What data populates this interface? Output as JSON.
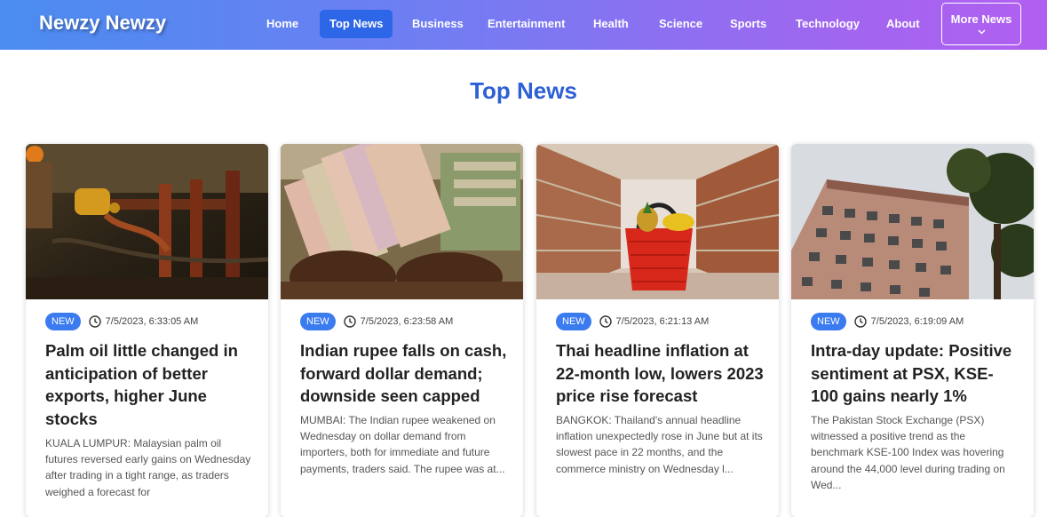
{
  "navbar": {
    "brand": "Newzy Newzy",
    "links": [
      "Home",
      "Top News",
      "Business",
      "Entertainment",
      "Health",
      "Science",
      "Sports",
      "Technology",
      "About"
    ],
    "active_link": "Top News",
    "more_label": "More News",
    "more_icon": "chevron-down-icon",
    "gradient_colors": [
      "#4a8cf0",
      "#b15ff0"
    ]
  },
  "page": {
    "title": "Top News",
    "title_color": "#2d5fd6"
  },
  "cards": [
    {
      "badge": "NEW",
      "time": "7/5/2023, 6:33:05 AM",
      "headline": "Palm oil little changed in anticipation of better exports, higher June stocks",
      "summary": "KUALA LUMPUR: Malaysian palm oil futures reversed early gains on Wednesday after trading in a tight range, as traders weighed a forecast for",
      "image_icon": "palm-oil-photo"
    },
    {
      "badge": "NEW",
      "time": "7/5/2023, 6:23:58 AM",
      "headline": "Indian rupee falls on cash, forward dollar demand; downside seen capped",
      "summary": "MUMBAI: The Indian rupee weakened on Wednesday on dollar demand from importers, both for immediate and future payments, traders said. The rupee was at...",
      "image_icon": "rupee-notes-photo"
    },
    {
      "badge": "NEW",
      "time": "7/5/2023, 6:21:13 AM",
      "headline": "Thai headline inflation at 22-month low, lowers 2023 price rise forecast",
      "summary": "BANGKOK: Thailand's annual headline inflation unexpectedly rose in June but at its slowest pace in 22 months, and the commerce ministry on Wednesday l...",
      "image_icon": "grocery-basket-photo"
    },
    {
      "badge": "NEW",
      "time": "7/5/2023, 6:19:09 AM",
      "headline": "Intra-day update: Positive sentiment at PSX, KSE-100 gains nearly 1%",
      "summary": "The Pakistan Stock Exchange (PSX) witnessed a positive trend as the benchmark KSE-100 Index was hovering around the 44,000 level during trading on Wed...",
      "image_icon": "psx-building-photo"
    }
  ]
}
